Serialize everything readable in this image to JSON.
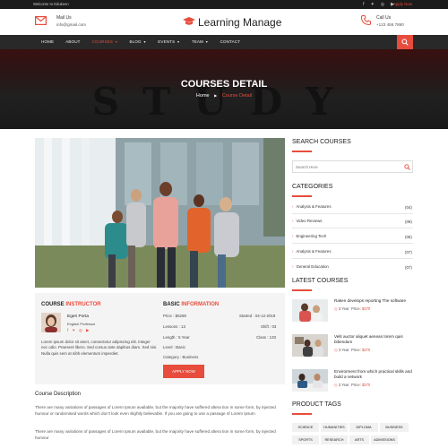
{
  "topbar": {
    "welcome": "Welcome to Edukeen",
    "socials": [
      "facebook-icon",
      "twitter-icon",
      "instagram-icon",
      "youtube-icon"
    ],
    "apply": "Apply Now"
  },
  "header": {
    "mail_label": "Mail Us",
    "mail_value": "info@gmail.com",
    "brand": "Learning Manage",
    "call_label": "Call Us",
    "call_value": "+123 456 7890"
  },
  "nav": {
    "items": [
      {
        "label": "HOME"
      },
      {
        "label": "ABOUT"
      },
      {
        "label": "COURSES"
      },
      {
        "label": "BLOG"
      },
      {
        "label": "EVENTS"
      },
      {
        "label": "TEAM"
      },
      {
        "label": "CONTACT"
      }
    ],
    "active": "COURSES"
  },
  "hero": {
    "ghost": "STUDY",
    "title": "COURSES DETAIL",
    "crumb_home": "Home",
    "crumb_sep": "▶",
    "crumb_current": "Course Detail"
  },
  "instructor": {
    "heading_a": "COURSE",
    "heading_b": "INSTRUCTOR",
    "name": "Egeri Porta",
    "role": "English Professor",
    "bio": "Lorem ipsum dolor sit amet, consectetur adipiscing elit. Integer nec odio. Praesent libero. Sed cursus ante dapibus diam. Sed nisi. Nulla quis sem at nibh elementum imperdiet."
  },
  "basic": {
    "heading_a": "BASIC",
    "heading_b": "INFORMATION",
    "price": "Price : $6269",
    "started": "Started : 04-12-2019",
    "lessons": "Lessons : 13",
    "shift": "Shift : 03",
    "length": "Length : 5 Year",
    "class": "Class : 133",
    "level": "Level : Basic",
    "category": "Category : Business",
    "apply_label": "APPLY NOW"
  },
  "description": {
    "heading": "Course Description",
    "p1": "There are many variations of passages of Lorem Ipsum available, but the majority have suffered altera tion in some form, by injected humour or randomised words which don't look even slightly believable. If you are going to use a passage of Lorem Ipsum",
    "p2": "There are many variations of passages of Lorem Ipsum available, but the majority have suffered altera tion in some form, by injected humour"
  },
  "sidebar": {
    "search_heading": "SEARCH COURSES",
    "search_placeholder": "Search Here",
    "categories_heading": "CATEGORIES",
    "categories": [
      {
        "label": "Analysis & Features",
        "count": "(04)"
      },
      {
        "label": "Video Reviews",
        "count": "(09)"
      },
      {
        "label": "Engineering Tech",
        "count": "(05)"
      },
      {
        "label": "Analysis & Features",
        "count": "(07)"
      },
      {
        "label": "General Education",
        "count": "(07)"
      }
    ],
    "latest_heading": "LATEST COURSES",
    "latest": [
      {
        "title": "Raken develops reporting The software",
        "duration": "3 Year",
        "price_label": "Price:",
        "price": "$370"
      },
      {
        "title": "Velit auctor aliquet aenean lorem quis bibendum",
        "duration": "3 Year",
        "price_label": "Price:",
        "price": "$370"
      },
      {
        "title": "Envirorment from which practical skills and build a network",
        "duration": "3 Year",
        "price_label": "Price:",
        "price": "$370"
      }
    ],
    "tags_heading": "PRODUCT TAGS",
    "tags": [
      "SCIENCE",
      "HUMANITIES",
      "DIPLOMA",
      "BUSINESS",
      "SPORTS",
      "RESEARCH",
      "ARTS",
      "ADMISSIONS"
    ]
  },
  "colors": {
    "accent": "#e74c3c",
    "dark": "#292929"
  }
}
